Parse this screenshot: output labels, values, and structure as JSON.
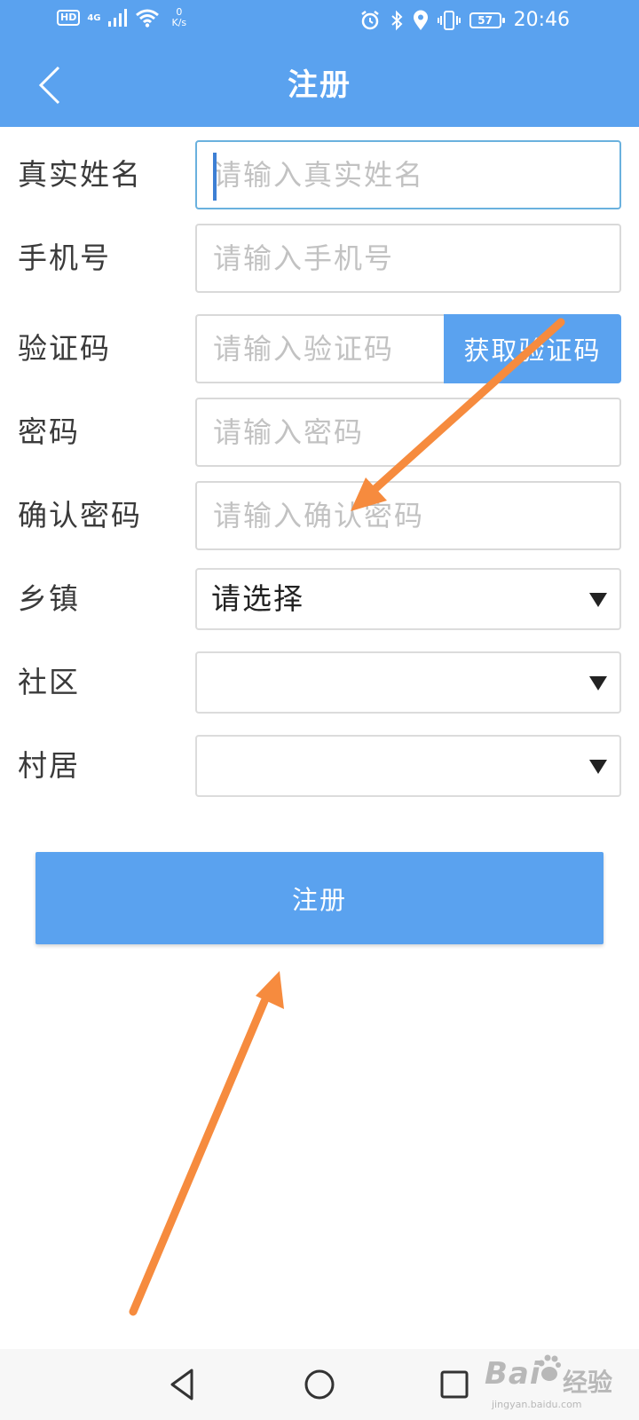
{
  "status_bar": {
    "hd": "HD",
    "network": "4G",
    "speed_value": "0",
    "speed_unit": "K/s",
    "battery": "57",
    "time": "20:46"
  },
  "header": {
    "title": "注册"
  },
  "form": {
    "real_name": {
      "label": "真实姓名",
      "placeholder": "请输入真实姓名"
    },
    "phone": {
      "label": "手机号",
      "placeholder": "请输入手机号"
    },
    "verification_code": {
      "label": "验证码",
      "placeholder": "请输入验证码",
      "button_label": "获取验证码"
    },
    "password": {
      "label": "密码",
      "placeholder": "请输入密码"
    },
    "confirm_password": {
      "label": "确认密码",
      "placeholder": "请输入确认密码"
    },
    "township": {
      "label": "乡镇",
      "selected": "请选择"
    },
    "community": {
      "label": "社区",
      "selected": ""
    },
    "village": {
      "label": "村居",
      "selected": ""
    }
  },
  "submit": {
    "label": "注册"
  },
  "colors": {
    "primary": "#5aa2ef",
    "annotation_arrow": "#f68b3e",
    "placeholder": "#c2c2c2"
  },
  "watermark": {
    "brand": "Bai",
    "product": "经验",
    "url": "jingyan.baidu.com"
  }
}
